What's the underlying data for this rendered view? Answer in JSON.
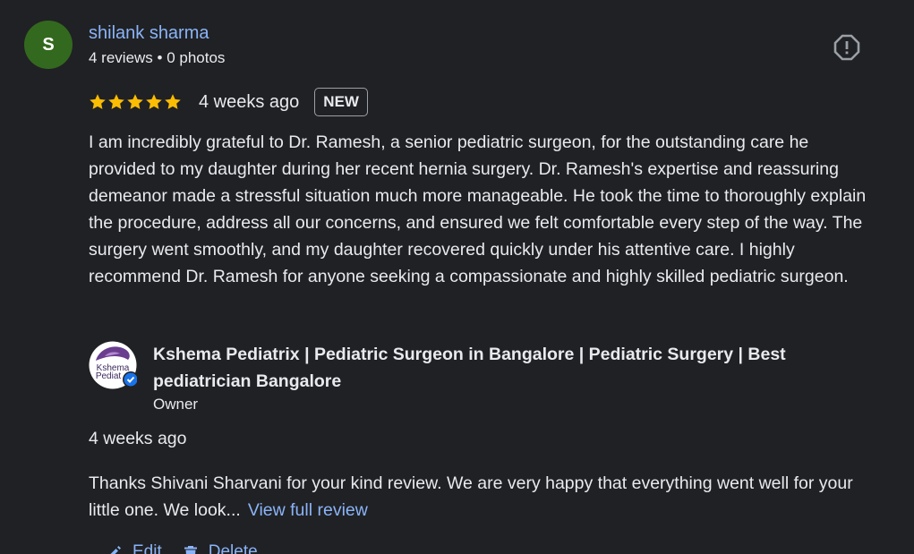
{
  "reviewer": {
    "initial": "S",
    "name": "shilank sharma",
    "meta": "4 reviews • 0 photos",
    "avatar_color": "#33691e"
  },
  "rating": {
    "stars": 5,
    "time_ago": "4 weeks ago",
    "badge": "NEW",
    "star_color": "#fbbc04"
  },
  "review_text": "I am incredibly grateful to Dr. Ramesh, a senior pediatric surgeon, for the outstanding care he provided to my daughter during her recent hernia surgery. Dr. Ramesh's expertise and reassuring demeanor made a stressful situation much more manageable. He took the time to thoroughly explain the procedure, address all our concerns, and ensured we felt comfortable every step of the way. The surgery went smoothly, and my daughter recovered quickly under his attentive care. I highly recommend Dr. Ramesh for anyone seeking a compassionate and highly skilled pediatric surgeon.",
  "owner": {
    "logo_text_line1": "Kshema",
    "logo_text_line2": "Pediat",
    "name": "Kshema Pediatrix | Pediatric Surgeon in Bangalore | Pediatric Surgery | Best pediatrician Bangalore",
    "role": "Owner",
    "verified_icon": "verified-check-icon"
  },
  "reply": {
    "time_ago": "4 weeks ago",
    "text": "Thanks Shivani Sharvani for your kind review. We are very happy that everything went well for your little one. We look...",
    "view_full_label": "View full review"
  },
  "actions": {
    "edit_label": "Edit",
    "delete_label": "Delete"
  },
  "colors": {
    "background": "#202124",
    "link": "#8ab4f8",
    "text": "#e8eaed"
  }
}
